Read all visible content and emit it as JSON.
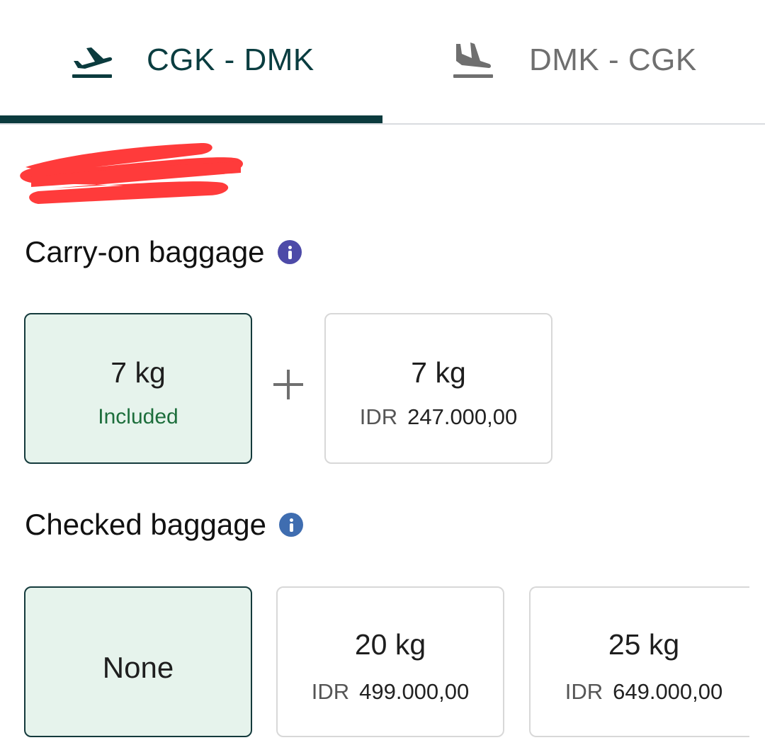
{
  "tabs": {
    "outbound": {
      "label": "CGK - DMK",
      "icon": "departure-plane-icon",
      "active": true
    },
    "return": {
      "label": "DMK - CGK",
      "icon": "arrival-plane-icon",
      "active": false
    }
  },
  "colors": {
    "primary": "#0b3b3e",
    "selected_bg": "#e6f3ec",
    "included_text": "#1d6e3c",
    "info_carry": "#4d4aa8",
    "info_checked": "#3f6db0",
    "redaction": "#ff3b3b"
  },
  "carry_on": {
    "title": "Carry-on baggage",
    "options": [
      {
        "weight": "7 kg",
        "note": "Included",
        "selected": true
      },
      {
        "weight": "7 kg",
        "currency": "IDR",
        "price": "247.000,00",
        "selected": false
      }
    ]
  },
  "checked": {
    "title": "Checked baggage",
    "options": [
      {
        "label": "None",
        "selected": true
      },
      {
        "weight": "20 kg",
        "currency": "IDR",
        "price": "499.000,00",
        "selected": false
      },
      {
        "weight": "25 kg",
        "currency": "IDR",
        "price": "649.000,00",
        "selected": false
      }
    ]
  }
}
